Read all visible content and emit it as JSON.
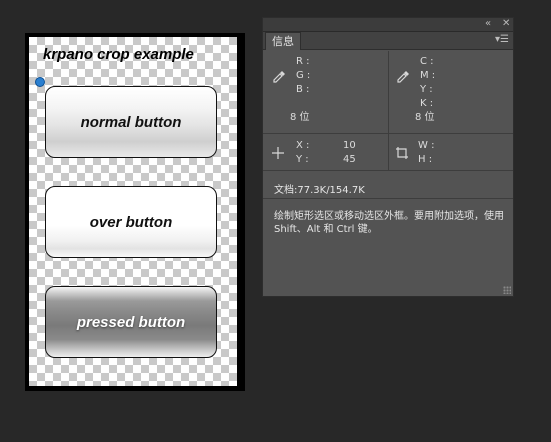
{
  "canvas": {
    "title": "krpano crop example",
    "buttons": [
      {
        "label": "normal button"
      },
      {
        "label": "over button"
      },
      {
        "label": "pressed button"
      }
    ]
  },
  "panel": {
    "tab": "信息",
    "collapse_icon": "double-chevron-icon",
    "close_icon": "close-icon",
    "menu_icon": "panel-menu-icon",
    "rgb": {
      "r_label": "R :",
      "g_label": "G :",
      "b_label": "B :",
      "bits": "8 位"
    },
    "cmyk": {
      "c_label": "C :",
      "m_label": "M :",
      "y_label": "Y :",
      "k_label": "K :",
      "bits": "8 位"
    },
    "position": {
      "x_label": "X :",
      "y_label": "Y :",
      "x_value": "10",
      "y_value": "45"
    },
    "size": {
      "w_label": "W :",
      "h_label": "H :"
    },
    "doc_info": "文档:77.3K/154.7K",
    "hint": "绘制矩形选区或移动选区外框。要用附加选项，使用 Shift、Alt 和 Ctrl 键。"
  },
  "colors": {
    "workspace": "#282828",
    "panel": "#535353",
    "panel_text": "#dcdcdc",
    "anchor": "#2a7fd0"
  }
}
